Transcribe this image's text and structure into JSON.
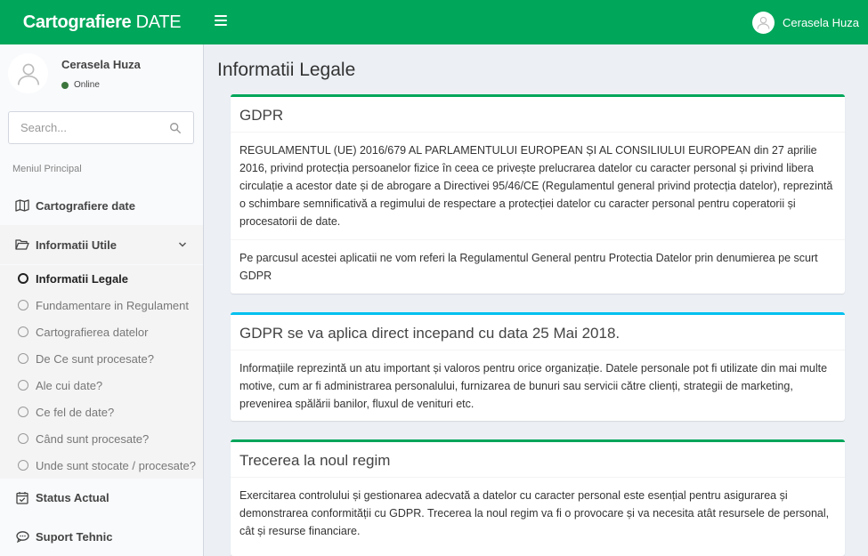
{
  "header": {
    "logo_bold": "Cartografiere",
    "logo_light": " DATE",
    "user_name": "Cerasela Huza"
  },
  "sidebar": {
    "user_name": "Cerasela Huza",
    "status": "Online",
    "search_placeholder": "Search...",
    "menu_header": "Meniul Principal",
    "items": [
      {
        "label": "Cartografiere date",
        "icon": "map-icon"
      },
      {
        "label": "Informatii Utile",
        "icon": "folder-open-icon"
      },
      {
        "label": "Status Actual",
        "icon": "calendar-check-icon"
      },
      {
        "label": "Suport Tehnic",
        "icon": "chat-icon"
      }
    ],
    "subitems": [
      {
        "label": "Informatii Legale",
        "active": true
      },
      {
        "label": "Fundamentare in Regulament"
      },
      {
        "label": "Cartografierea datelor"
      },
      {
        "label": "De Ce sunt procesate?"
      },
      {
        "label": "Ale cui date?"
      },
      {
        "label": "Ce fel de date?"
      },
      {
        "label": "Când sunt procesate?"
      },
      {
        "label": "Unde sunt stocate / procesate?"
      }
    ]
  },
  "main": {
    "page_title": "Informatii Legale",
    "boxes": [
      {
        "title": "GDPR",
        "body": "REGULAMENTUL (UE) 2016/679 AL PARLAMENTULUI EUROPEAN ȘI AL CONSILIULUI EUROPEAN din 27 aprilie 2016, privind protecția persoanelor fizice în ceea ce privește prelucrarea datelor cu caracter personal și privind libera circulație a acestor date și de abrogare a Directivei 95/46/CE (Regulamentul general privind protecția datelor), reprezintă o schimbare semnificativă a regimului de respectare a protecției datelor cu caracter personal pentru coperatorii și procesatorii de date.",
        "footer": "Pe parcusul acestei aplicatii ne vom referi la Regulamentul General pentru Protectia Datelor prin denumierea pe scurt GDPR"
      },
      {
        "title": "GDPR se va aplica direct incepand cu data 25 Mai 2018.",
        "body": "Informațiile reprezintă un atu important și valoros pentru orice organizație. Datele personale pot fi utilizate din mai multe motive, cum ar fi administrarea personalului, furnizarea de bunuri sau servicii către clienți, strategii de marketing, prevenirea spălării banilor, fluxul de venituri etc."
      },
      {
        "title": "Trecerea la noul regim",
        "body": "Exercitarea controlului și gestionarea adecvată a datelor cu caracter personal este esențial pentru asigurarea și demonstrarea conformității cu GDPR. Trecerea la noul regim va fi o provocare și va necesita atât resursele de personal, cât și resurse financiare."
      }
    ]
  },
  "colors": {
    "brand_green": "#00a65a",
    "info_cyan": "#00c0ef",
    "online_dot": "#3c763d"
  }
}
